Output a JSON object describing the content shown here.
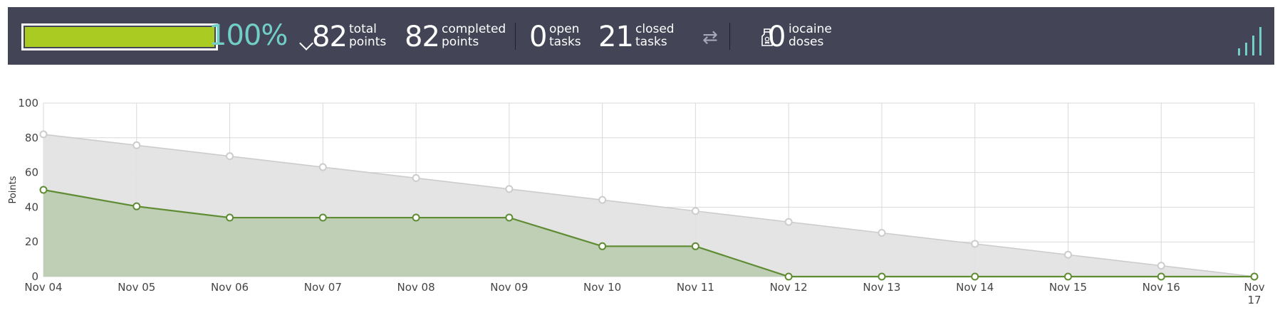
{
  "stats": {
    "progress": 1.0,
    "progress_color": "#a9cb22",
    "percent_text": "100%",
    "total_points": "82",
    "total_points_label": "total\npoints",
    "completed_points": "82",
    "completed_points_label": "completed\npoints",
    "open_tasks": "0",
    "open_tasks_label": "open\ntasks",
    "closed_tasks": "21",
    "closed_tasks_label": "closed\ntasks",
    "iocaine_doses": "0",
    "iocaine_doses_label": "iocaine\ndoses",
    "icons": [
      "chevron-down-icon",
      "swap-arrows-icon",
      "potion-bottle-icon",
      "signal-bars-icon"
    ]
  },
  "chart_data": {
    "type": "area",
    "ylabel": "Points",
    "xlabel": "",
    "ylim": [
      0,
      100
    ],
    "yticks": [
      0,
      20,
      40,
      60,
      80,
      100
    ],
    "grid": true,
    "categories": [
      "Nov 04",
      "Nov 05",
      "Nov 06",
      "Nov 07",
      "Nov 08",
      "Nov 09",
      "Nov 10",
      "Nov 11",
      "Nov 12",
      "Nov 13",
      "Nov 14",
      "Nov 15",
      "Nov 16",
      "Nov 17"
    ],
    "series": [
      {
        "key": "optimal",
        "color": "#cccccc",
        "fill": "#e3e3e3",
        "values": [
          82,
          75.7,
          69.4,
          63.1,
          56.8,
          50.5,
          44.2,
          37.8,
          31.5,
          25.2,
          18.9,
          12.6,
          6.3,
          0
        ]
      },
      {
        "key": "real",
        "color": "#5f8c33",
        "fill": "#bccdb3",
        "values": [
          50,
          40.5,
          34,
          34,
          34,
          34,
          17.5,
          17.5,
          0,
          0,
          0,
          0,
          0,
          0
        ]
      }
    ]
  }
}
